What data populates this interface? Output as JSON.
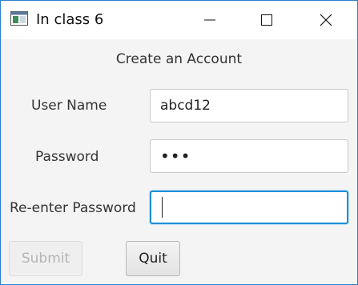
{
  "window": {
    "title": "In class 6",
    "icon": "app-window-icon",
    "controls": [
      "minimize-icon",
      "maximize-icon",
      "close-icon"
    ]
  },
  "form": {
    "heading": "Create an Account",
    "user_name_label": "User Name",
    "user_name_value": "abcd12",
    "password_label": "Password",
    "password_value": "•••",
    "reenter_label": "Re-enter Password",
    "reenter_value": ""
  },
  "buttons": {
    "submit_label": "Submit",
    "submit_enabled": false,
    "quit_label": "Quit"
  },
  "colors": {
    "focus_border": "#1e8fd6",
    "window_border": "#2b7fd0"
  }
}
